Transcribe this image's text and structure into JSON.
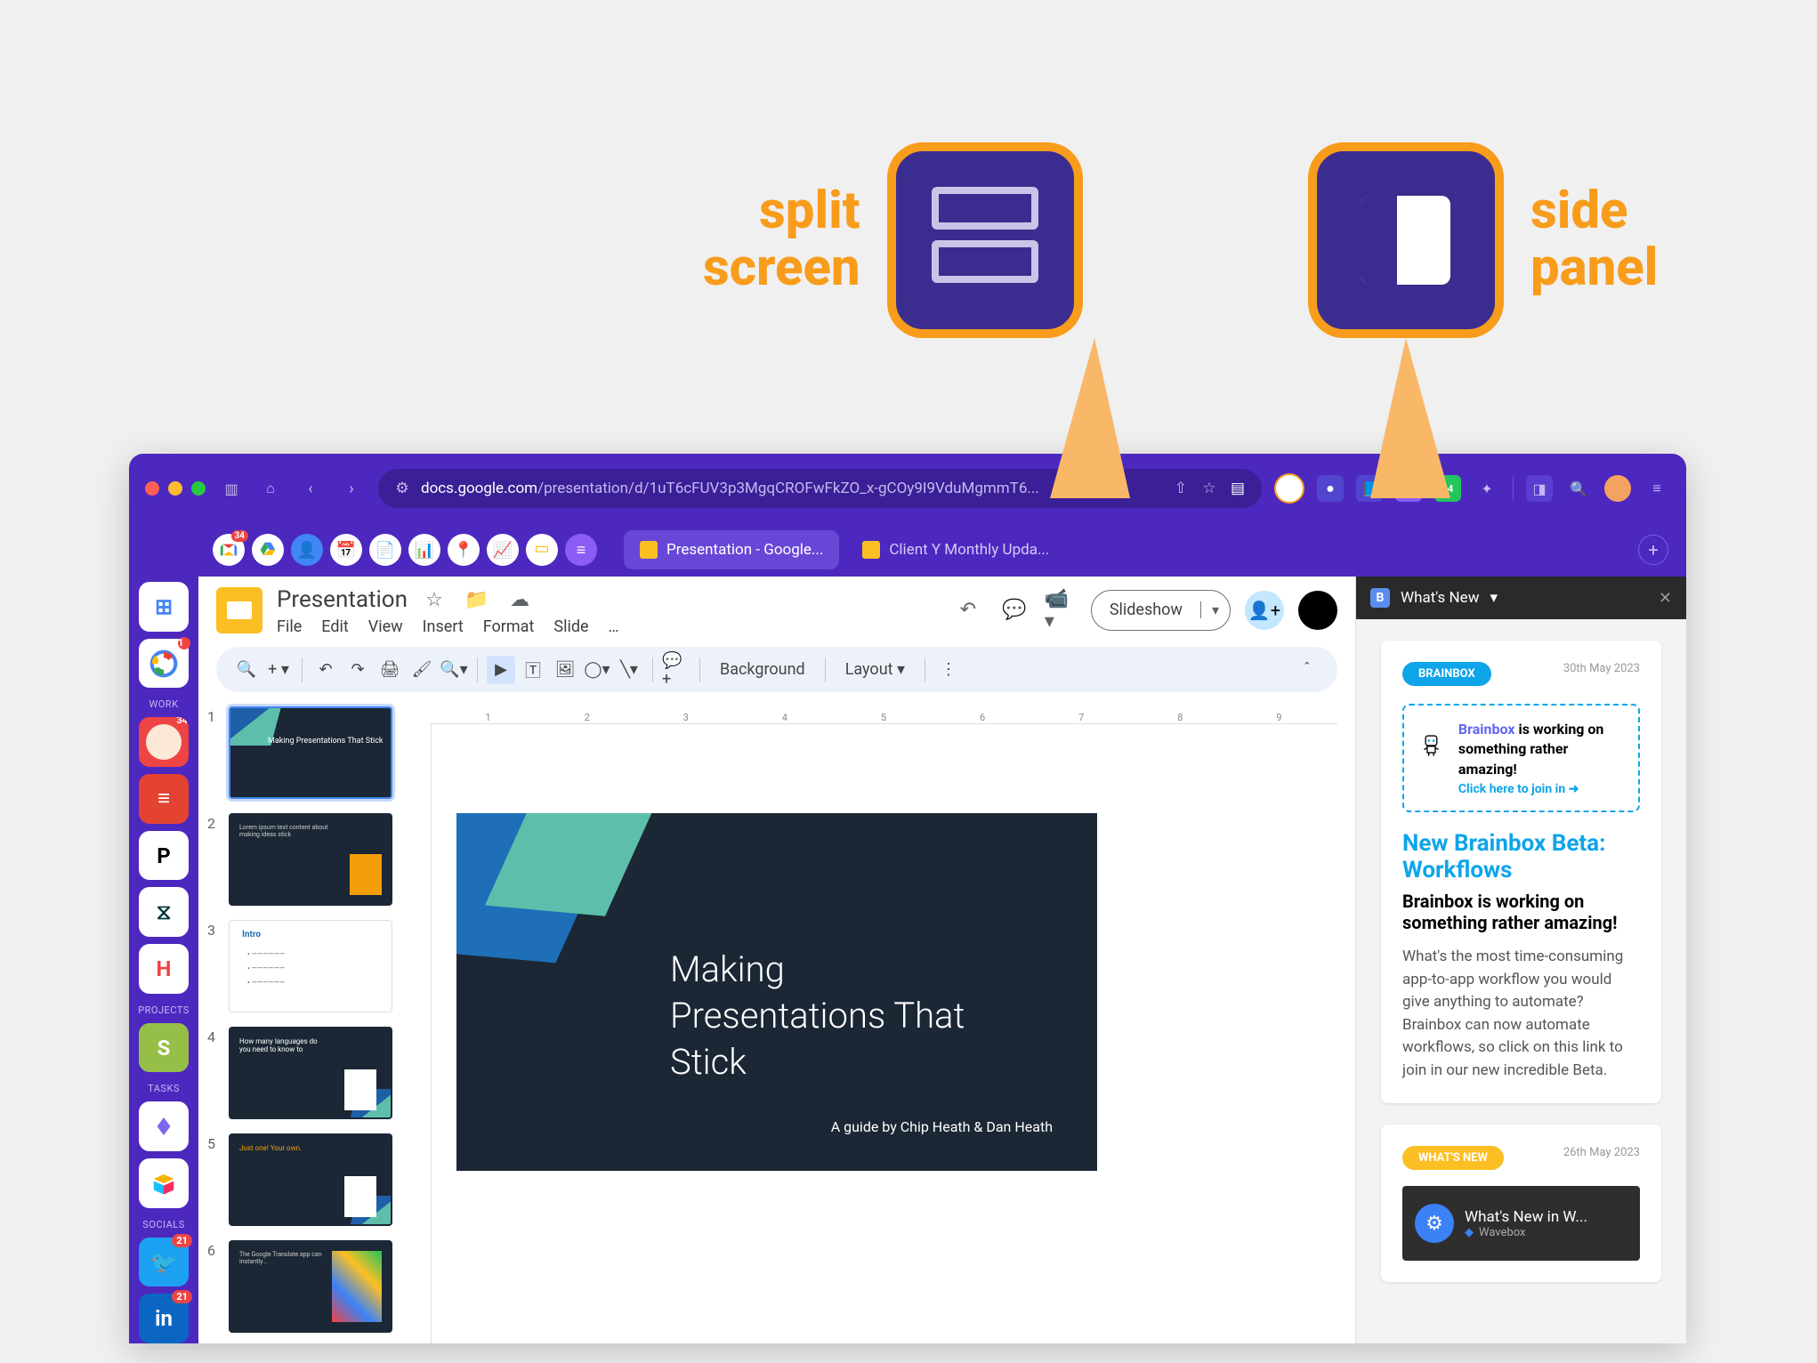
{
  "callouts": {
    "split": "split\nscreen",
    "side": "side\npanel"
  },
  "browser": {
    "url_domain": "docs.google.com",
    "url_path": "/presentation/d/1uT6cFUV3p3MgqCROFwFkZO_x-gCOy9I9VduMgmmT6...",
    "ext_badge": "14"
  },
  "mini_icons_badge": "34",
  "tabs": [
    {
      "label": "Presentation - Google...",
      "active": true
    },
    {
      "label": "Client Y Monthly Upda...",
      "active": false
    }
  ],
  "sidebar": {
    "sections": [
      "WORK",
      "PROJECTS",
      "TASKS",
      "SOCIALS"
    ],
    "badges": {
      "avatar": "34",
      "twitter": "21",
      "linkedin": "21"
    }
  },
  "slides": {
    "title": "Presentation",
    "menus": [
      "File",
      "Edit",
      "View",
      "Insert",
      "Format",
      "Slide",
      "…"
    ],
    "slideshow": "Slideshow",
    "toolbar_text": [
      "Background",
      "Layout"
    ],
    "ruler_ticks": [
      "1",
      "2",
      "3",
      "4",
      "5",
      "6",
      "7",
      "8",
      "9"
    ],
    "canvas_title": "Making\nPresentations That\nStick",
    "canvas_sub": "A guide by Chip Heath & Dan Heath",
    "thumbs": [
      {
        "num": "1",
        "title": "Making Presentations That Stick",
        "dark": true
      },
      {
        "num": "2",
        "title": "",
        "dark": true
      },
      {
        "num": "3",
        "title": "Intro",
        "dark": false
      },
      {
        "num": "4",
        "title": "How many languages do you need to know to",
        "dark": true
      },
      {
        "num": "5",
        "title": "Just one! Your own.",
        "dark": true
      },
      {
        "num": "6",
        "title": "",
        "dark": true
      }
    ]
  },
  "side_panel": {
    "header": "What's New",
    "card1": {
      "pill": "BRAINBOX",
      "date": "30th May 2023",
      "promo_brand": "Brainbox",
      "promo_text": " is working on something rather amazing!",
      "promo_link": "Click here to join in",
      "h2": "New Brainbox Beta: Workflows",
      "h3": "Brainbox is working on something rather amazing!",
      "p": "What's the most time-consuming app-to-app workflow you would give anything to automate? Brainbox can now automate workflows, so click on this link to join in our new incredible Beta."
    },
    "card2": {
      "pill": "WHAT'S NEW",
      "date": "26th May 2023",
      "video_title": "What's New in W...",
      "video_brand": "Wavebox"
    }
  }
}
